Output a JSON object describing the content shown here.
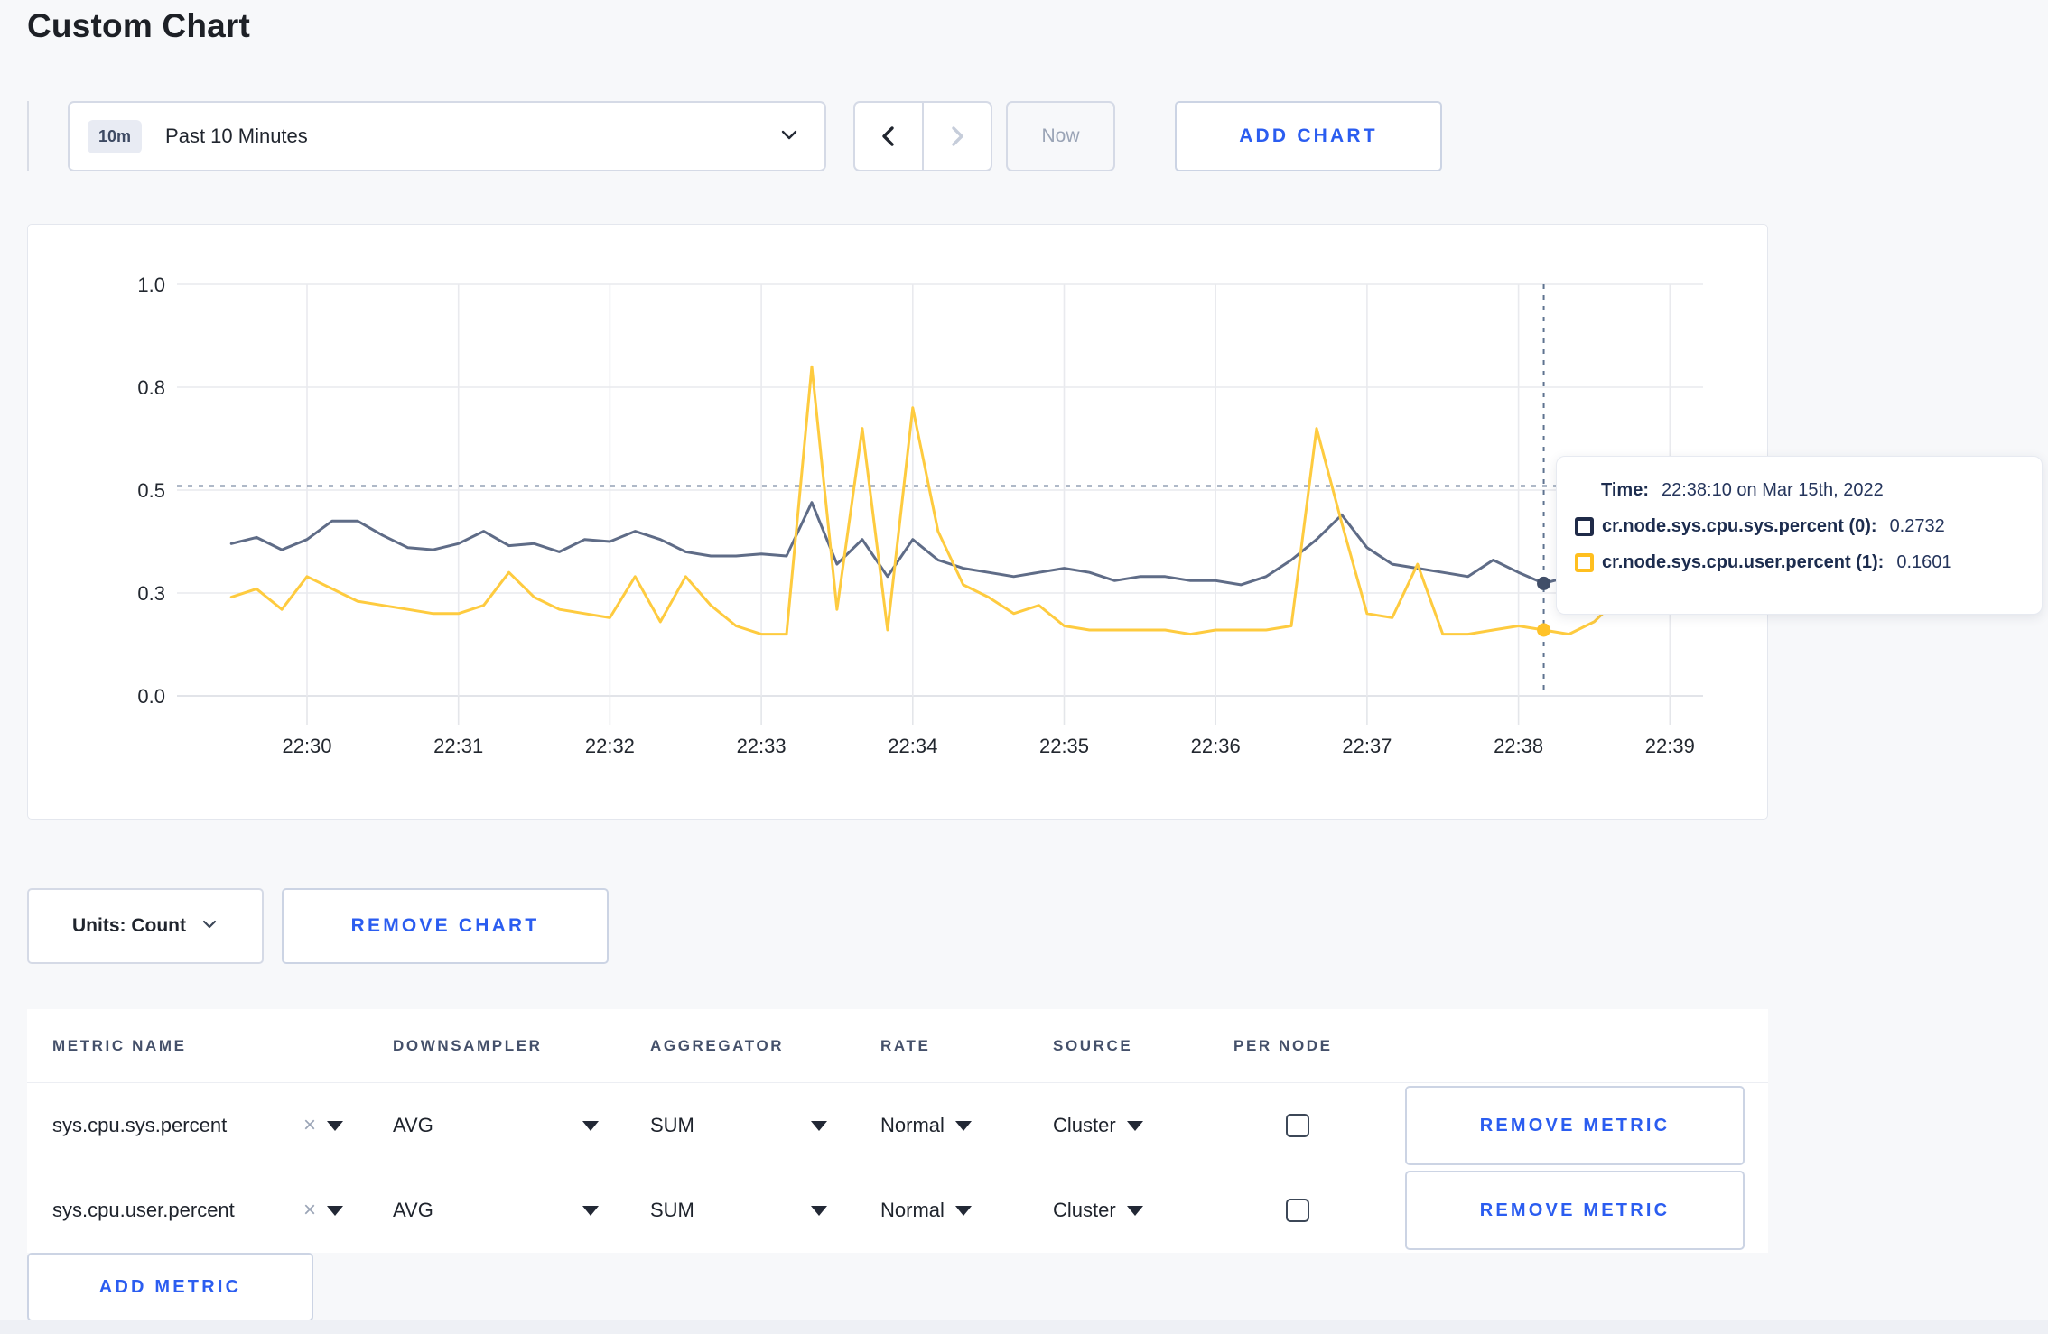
{
  "page": {
    "title": "Custom Chart"
  },
  "toolbar": {
    "time_window_badge": "10m",
    "time_window_label": "Past 10 Minutes",
    "now_label": "Now",
    "add_chart_label": "ADD CHART"
  },
  "chart_data": {
    "type": "line",
    "title": "",
    "xlabel": "",
    "ylabel": "",
    "ylim": [
      0,
      1
    ],
    "grid": true,
    "x_unit": "seconds after 22:30:00",
    "x_ticks": [
      {
        "t": 0,
        "label": "22:30"
      },
      {
        "t": 60,
        "label": "22:31"
      },
      {
        "t": 120,
        "label": "22:32"
      },
      {
        "t": 180,
        "label": "22:33"
      },
      {
        "t": 240,
        "label": "22:34"
      },
      {
        "t": 300,
        "label": "22:35"
      },
      {
        "t": 360,
        "label": "22:36"
      },
      {
        "t": 420,
        "label": "22:37"
      },
      {
        "t": 480,
        "label": "22:38"
      },
      {
        "t": 540,
        "label": "22:39"
      }
    ],
    "y_ticks": [
      {
        "pos": 1.0,
        "label": "1.0"
      },
      {
        "pos": 0.75,
        "label": "0.8"
      },
      {
        "pos": 0.5,
        "label": "0.5"
      },
      {
        "pos": 0.25,
        "label": "0.3"
      },
      {
        "pos": 0.0,
        "label": "0.0"
      }
    ],
    "series": [
      {
        "name": "cr.node.sys.cpu.sys.percent",
        "color": "#5f6c87",
        "dot_color": "#414e68",
        "points": [
          [
            -30,
            0.37
          ],
          [
            -20,
            0.385
          ],
          [
            -10,
            0.355
          ],
          [
            0,
            0.38
          ],
          [
            10,
            0.425
          ],
          [
            20,
            0.425
          ],
          [
            30,
            0.39
          ],
          [
            40,
            0.36
          ],
          [
            50,
            0.355
          ],
          [
            60,
            0.37
          ],
          [
            70,
            0.4
          ],
          [
            80,
            0.365
          ],
          [
            90,
            0.37
          ],
          [
            100,
            0.35
          ],
          [
            110,
            0.38
          ],
          [
            120,
            0.375
          ],
          [
            130,
            0.4
          ],
          [
            140,
            0.38
          ],
          [
            150,
            0.35
          ],
          [
            160,
            0.34
          ],
          [
            170,
            0.34
          ],
          [
            180,
            0.345
          ],
          [
            190,
            0.34
          ],
          [
            200,
            0.47
          ],
          [
            210,
            0.32
          ],
          [
            220,
            0.38
          ],
          [
            230,
            0.29
          ],
          [
            240,
            0.38
          ],
          [
            250,
            0.33
          ],
          [
            260,
            0.31
          ],
          [
            270,
            0.3
          ],
          [
            280,
            0.29
          ],
          [
            290,
            0.3
          ],
          [
            300,
            0.31
          ],
          [
            310,
            0.3
          ],
          [
            320,
            0.28
          ],
          [
            330,
            0.29
          ],
          [
            340,
            0.29
          ],
          [
            350,
            0.28
          ],
          [
            360,
            0.28
          ],
          [
            370,
            0.27
          ],
          [
            380,
            0.29
          ],
          [
            390,
            0.33
          ],
          [
            400,
            0.38
          ],
          [
            410,
            0.44
          ],
          [
            420,
            0.36
          ],
          [
            430,
            0.32
          ],
          [
            440,
            0.31
          ],
          [
            450,
            0.3
          ],
          [
            460,
            0.29
          ],
          [
            470,
            0.33
          ],
          [
            480,
            0.3
          ],
          [
            490,
            0.2732
          ],
          [
            500,
            0.29
          ],
          [
            510,
            0.31
          ],
          [
            520,
            0.3
          ],
          [
            530,
            0.3
          ],
          [
            540,
            0.3
          ],
          [
            550,
            0.29
          ]
        ]
      },
      {
        "name": "cr.node.sys.cpu.user.percent",
        "color": "#fecb3f",
        "dot_color": "#ffc228",
        "points": [
          [
            -30,
            0.24
          ],
          [
            -20,
            0.26
          ],
          [
            -10,
            0.21
          ],
          [
            0,
            0.29
          ],
          [
            10,
            0.26
          ],
          [
            20,
            0.23
          ],
          [
            30,
            0.22
          ],
          [
            40,
            0.21
          ],
          [
            50,
            0.2
          ],
          [
            60,
            0.2
          ],
          [
            70,
            0.22
          ],
          [
            80,
            0.3
          ],
          [
            90,
            0.24
          ],
          [
            100,
            0.21
          ],
          [
            110,
            0.2
          ],
          [
            120,
            0.19
          ],
          [
            130,
            0.29
          ],
          [
            140,
            0.18
          ],
          [
            150,
            0.29
          ],
          [
            160,
            0.22
          ],
          [
            170,
            0.17
          ],
          [
            180,
            0.15
          ],
          [
            190,
            0.15
          ],
          [
            200,
            0.8
          ],
          [
            210,
            0.21
          ],
          [
            220,
            0.65
          ],
          [
            230,
            0.16
          ],
          [
            240,
            0.7
          ],
          [
            250,
            0.4
          ],
          [
            260,
            0.27
          ],
          [
            270,
            0.24
          ],
          [
            280,
            0.2
          ],
          [
            290,
            0.22
          ],
          [
            300,
            0.17
          ],
          [
            310,
            0.16
          ],
          [
            320,
            0.16
          ],
          [
            330,
            0.16
          ],
          [
            340,
            0.16
          ],
          [
            350,
            0.15
          ],
          [
            360,
            0.16
          ],
          [
            370,
            0.16
          ],
          [
            380,
            0.16
          ],
          [
            390,
            0.17
          ],
          [
            400,
            0.65
          ],
          [
            410,
            0.42
          ],
          [
            420,
            0.2
          ],
          [
            430,
            0.19
          ],
          [
            440,
            0.32
          ],
          [
            450,
            0.15
          ],
          [
            460,
            0.15
          ],
          [
            470,
            0.16
          ],
          [
            480,
            0.17
          ],
          [
            490,
            0.1601
          ],
          [
            500,
            0.15
          ],
          [
            510,
            0.18
          ],
          [
            520,
            0.24
          ],
          [
            530,
            0.27
          ],
          [
            540,
            0.21
          ],
          [
            550,
            0.27
          ]
        ]
      }
    ],
    "hover": {
      "time_t": 490,
      "guide_value": 0.51,
      "series_values": [
        0.2732,
        0.1601
      ]
    },
    "legend_position": "tooltip-only"
  },
  "tooltip": {
    "time_label": "Time:",
    "time_value": "22:38:10 on Mar 15th, 2022",
    "rows": [
      {
        "label": "cr.node.sys.cpu.sys.percent (0):",
        "value": "0.2732",
        "swatch": "#1f2a48"
      },
      {
        "label": "cr.node.sys.cpu.user.percent (1):",
        "value": "0.1601",
        "swatch": "#ffbf1f"
      }
    ]
  },
  "chart_footer": {
    "units_label": "Units: Count",
    "remove_chart_label": "REMOVE CHART"
  },
  "metrics_table": {
    "headers": [
      "METRIC NAME",
      "DOWNSAMPLER",
      "AGGREGATOR",
      "RATE",
      "SOURCE",
      "PER NODE"
    ],
    "rows": [
      {
        "metric": "sys.cpu.sys.percent",
        "downsampler": "AVG",
        "aggregator": "SUM",
        "rate": "Normal",
        "source": "Cluster",
        "per_node_checked": false,
        "remove_label": "REMOVE METRIC"
      },
      {
        "metric": "sys.cpu.user.percent",
        "downsampler": "AVG",
        "aggregator": "SUM",
        "rate": "Normal",
        "source": "Cluster",
        "per_node_checked": false,
        "remove_label": "REMOVE METRIC"
      }
    ],
    "add_metric_label": "ADD METRIC"
  }
}
